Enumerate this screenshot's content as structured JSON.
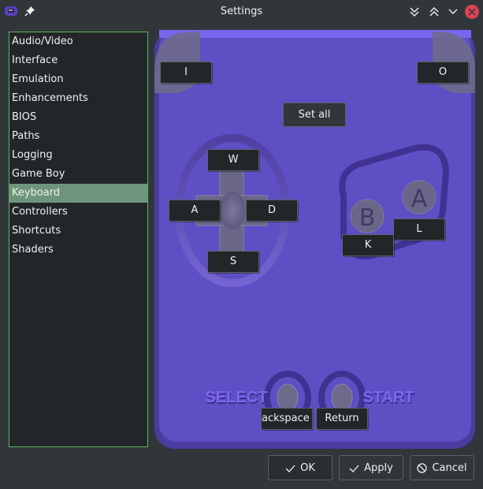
{
  "window": {
    "title": "Settings",
    "icons": {
      "app": "gba-app-icon",
      "pin": "pin-icon",
      "minimize": "double-chevron-down-icon",
      "maximize": "double-chevron-up-icon",
      "shade": "chevron-down-icon",
      "close": "close-icon"
    }
  },
  "sidebar": {
    "selected_index": 8,
    "items": [
      {
        "label": "Audio/Video"
      },
      {
        "label": "Interface"
      },
      {
        "label": "Emulation"
      },
      {
        "label": "Enhancements"
      },
      {
        "label": "BIOS"
      },
      {
        "label": "Paths"
      },
      {
        "label": "Logging"
      },
      {
        "label": "Game Boy"
      },
      {
        "label": "Keyboard"
      },
      {
        "label": "Controllers"
      },
      {
        "label": "Shortcuts"
      },
      {
        "label": "Shaders"
      }
    ]
  },
  "keymap": {
    "set_all_label": "Set all",
    "l_shoulder": "I",
    "r_shoulder": "O",
    "up": "W",
    "left": "A",
    "right": "D",
    "down": "S",
    "a_button": "L",
    "b_button": "K",
    "select": "ackspace",
    "start": "Return",
    "select_text": "SELECT",
    "start_text": "START",
    "a_glyph": "A",
    "b_glyph": "B",
    "colors": {
      "body": "#5f4fc4",
      "body_edge": "#4a3c9e",
      "button_gray": "#6e6a8c",
      "label_purple": "#7b68ee"
    }
  },
  "footer": {
    "ok_label": "OK",
    "apply_label": "Apply",
    "cancel_label": "Cancel"
  },
  "colors": {
    "window_bg": "#31363b",
    "list_bg": "#232629",
    "list_border": "#5cb85c",
    "selection": "#6e957b",
    "close_red": "#da4453"
  }
}
